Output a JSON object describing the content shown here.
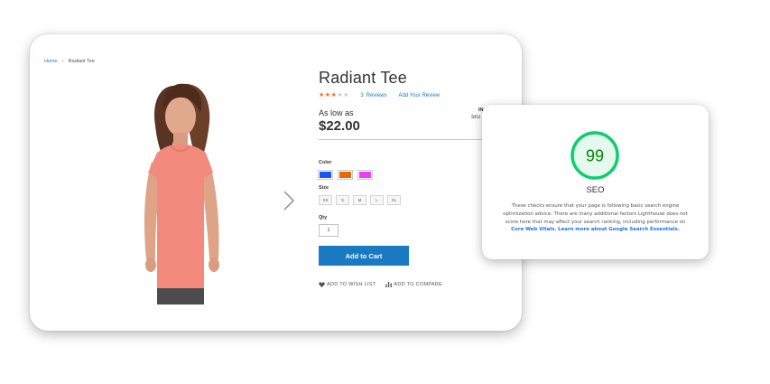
{
  "breadcrumb": {
    "home": "Home",
    "current": "Radiant Tee"
  },
  "product": {
    "title": "Radiant Tee",
    "rating": {
      "filled_stars": 3,
      "total_stars": 5,
      "review_count": "3",
      "reviews_word": "Reviews",
      "add_review": "Add Your Review"
    },
    "price_label": "As low as",
    "price": "$22.00",
    "stock": "IN",
    "sku": "SKU"
  },
  "options": {
    "color_label": "Color",
    "colors": [
      "#1857f7",
      "#eb6703",
      "#ef3dff"
    ],
    "size_label": "Size",
    "sizes": [
      "XS",
      "S",
      "M",
      "L",
      "XL"
    ],
    "qty_label": "Qty",
    "qty_value": "1"
  },
  "buttons": {
    "add_to_cart": "Add to Cart",
    "wish_list": "ADD TO WISH LIST",
    "compare": "ADD TO COMPARE"
  },
  "seo": {
    "score": "99",
    "score_fraction": 0.99,
    "title": "SEO",
    "description": "These checks ensure that your page is following basic search engine optimization advice. There are many additional factors Lighthouse does not score here that may affect your search ranking, including performance on",
    "link1": "Core Web Vitals.",
    "link2": "Learn more about Google Search Essentials.",
    "colors": {
      "pass": "#0cce6b",
      "pass_bg": "#e5f9ee",
      "pass_text": "#008800"
    }
  }
}
